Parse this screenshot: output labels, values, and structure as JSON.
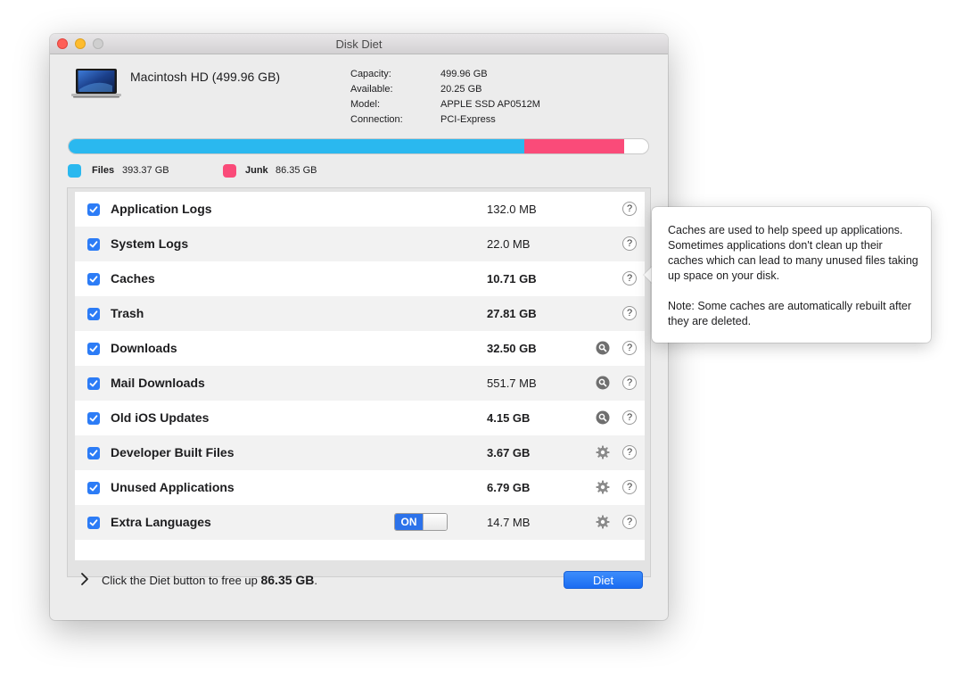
{
  "window": {
    "title": "Disk Diet"
  },
  "disk": {
    "name": "Macintosh HD (499.96 GB)",
    "info": [
      {
        "label": "Capacity:",
        "value": "499.96 GB"
      },
      {
        "label": "Available:",
        "value": "20.25 GB"
      },
      {
        "label": "Model:",
        "value": "APPLE SSD AP0512M"
      },
      {
        "label": "Connection:",
        "value": "PCI-Express"
      }
    ]
  },
  "usage": {
    "files_fraction": 0.7868,
    "junk_fraction": 0.1727,
    "colors": {
      "files": "#2ab8ef",
      "junk": "#fa4b79"
    }
  },
  "legend": {
    "files_label": "Files",
    "files_value": "393.37 GB",
    "junk_label": "Junk",
    "junk_value": "86.35 GB"
  },
  "items": [
    {
      "label": "Application Logs",
      "size": "132.0 MB",
      "checked": true,
      "icon": "none"
    },
    {
      "label": "System Logs",
      "size": "22.0 MB",
      "checked": true,
      "icon": "none"
    },
    {
      "label": "Caches",
      "size": "10.71 GB",
      "checked": true,
      "icon": "none"
    },
    {
      "label": "Trash",
      "size": "27.81 GB",
      "checked": true,
      "icon": "none"
    },
    {
      "label": "Downloads",
      "size": "32.50 GB",
      "checked": true,
      "icon": "magnifier-icon"
    },
    {
      "label": "Mail Downloads",
      "size": "551.7 MB",
      "checked": true,
      "icon": "magnifier-icon"
    },
    {
      "label": "Old iOS Updates",
      "size": "4.15 GB",
      "checked": true,
      "icon": "magnifier-icon"
    },
    {
      "label": "Developer Built Files",
      "size": "3.67 GB",
      "checked": true,
      "icon": "gear-icon"
    },
    {
      "label": "Unused Applications",
      "size": "6.79 GB",
      "checked": true,
      "icon": "gear-icon"
    },
    {
      "label": "Extra Languages",
      "size": "14.7 MB",
      "checked": true,
      "icon": "gear-icon",
      "toggle": "ON"
    }
  ],
  "help_label": "?",
  "footer": {
    "text_prefix": "Click the Diet button to free up ",
    "amount": "86.35 GB",
    "text_suffix": ".",
    "button_label": "Diet"
  },
  "popover": {
    "paragraph1": "Caches are used to help speed up applications.  Sometimes applications don't clean up their caches which can lead to many unused files taking up space on your disk.",
    "paragraph2": "Note: Some caches are automatically rebuilt after they are deleted."
  }
}
